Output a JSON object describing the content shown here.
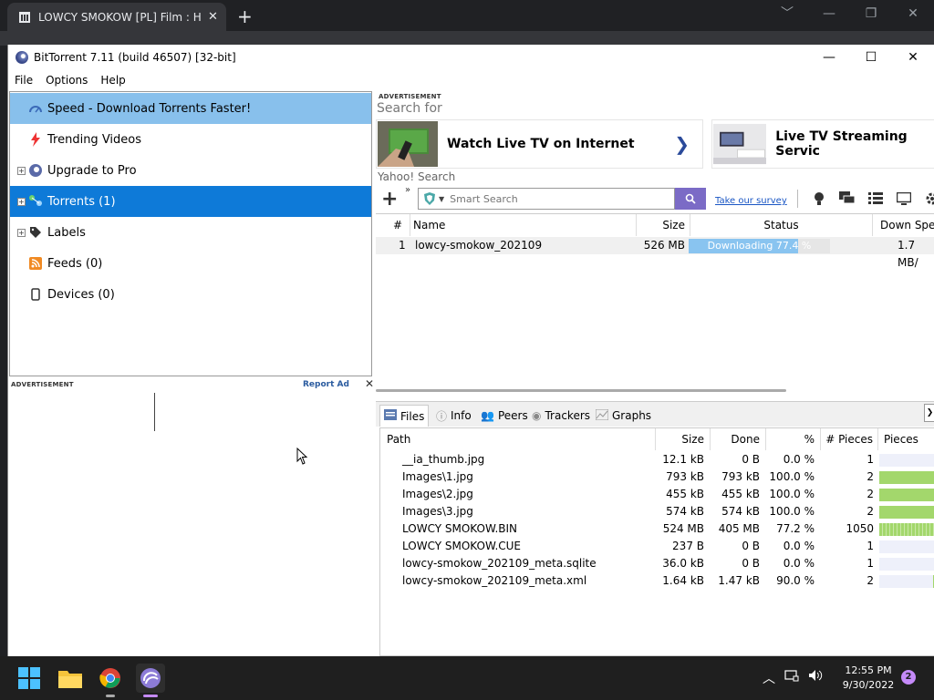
{
  "chrome": {
    "tab_title": "LOWCY SMOKOW [PL] Film : HAC",
    "tab_close": "✕",
    "new_tab": "+",
    "min": "﹀",
    "minimize": "—",
    "restore": "❐",
    "close": "✕"
  },
  "app": {
    "title": "BitTorrent 7.11  (build 46507) [32-bit]",
    "min": "—",
    "max": "☐",
    "close": "✕"
  },
  "menu": [
    "File",
    "Options",
    "Help"
  ],
  "sidebar": {
    "items": [
      {
        "label": "Speed - Download Torrents Faster!"
      },
      {
        "label": "Trending Videos"
      },
      {
        "label": "Upgrade to Pro"
      },
      {
        "label": "Torrents (1)"
      },
      {
        "label": "Labels"
      },
      {
        "label": "Feeds (0)"
      },
      {
        "label": "Devices (0)"
      }
    ],
    "expander": "+"
  },
  "side_ad": {
    "tag": "ADVERTISEMENT",
    "report": "Report Ad",
    "close": "✕"
  },
  "top_ad": {
    "tag": "ADVERTISEMENT",
    "search_for": "Search for",
    "banner1": "Watch Live TV on Internet",
    "banner1_chev": "❯",
    "banner2": "Live TV Streaming Servic",
    "yahoo": "Yahoo! Search"
  },
  "toolbar": {
    "add": "+",
    "more": "»",
    "search_placeholder": "Smart Search",
    "survey": "Take our survey"
  },
  "torrents": {
    "columns": [
      "#",
      "Name",
      "Size",
      "Status",
      "Down Speed"
    ],
    "rows": [
      {
        "num": "1",
        "name": "lowcy-smokow_202109",
        "size": "526 MB",
        "status": "Downloading 77.4 %",
        "progress": 0.774,
        "down": "1.7 MB/"
      }
    ]
  },
  "tabs": [
    "Files",
    "Info",
    "Peers",
    "Trackers",
    "Graphs"
  ],
  "tabs_collapse": "❯",
  "files": {
    "columns": [
      "Path",
      "Size",
      "Done",
      "%",
      "# Pieces",
      "Pieces"
    ],
    "rows": [
      {
        "path": "__ia_thumb.jpg",
        "size": "12.1 kB",
        "done": "0 B",
        "pct": "0.0 %",
        "pieces": "1",
        "fill": 0
      },
      {
        "path": "Images\\1.jpg",
        "size": "793 kB",
        "done": "793 kB",
        "pct": "100.0 %",
        "pieces": "2",
        "fill": 1
      },
      {
        "path": "Images\\2.jpg",
        "size": "455 kB",
        "done": "455 kB",
        "pct": "100.0 %",
        "pieces": "2",
        "fill": 1
      },
      {
        "path": "Images\\3.jpg",
        "size": "574 kB",
        "done": "574 kB",
        "pct": "100.0 %",
        "pieces": "2",
        "fill": 1
      },
      {
        "path": "LOWCY SMOKOW.BIN",
        "size": "524 MB",
        "done": "405 MB",
        "pct": "77.2 %",
        "pieces": "1050",
        "fill": 0.772
      },
      {
        "path": "LOWCY SMOKOW.CUE",
        "size": "237 B",
        "done": "0 B",
        "pct": "0.0 %",
        "pieces": "1",
        "fill": 0
      },
      {
        "path": "lowcy-smokow_202109_meta.sqlite",
        "size": "36.0 kB",
        "done": "0 B",
        "pct": "0.0 %",
        "pieces": "1",
        "fill": 0
      },
      {
        "path": "lowcy-smokow_202109_meta.xml",
        "size": "1.64 kB",
        "done": "1.47 kB",
        "pct": "90.0 %",
        "pieces": "2",
        "fill": 0.9
      }
    ]
  },
  "taskbar": {
    "tray_up": "︿",
    "time": "12:55 PM",
    "date": "9/30/2022",
    "notifications": "2"
  },
  "colors": {
    "selected_light": "#88c0ec",
    "selected_dark": "#0e7ad8",
    "progress": "#89c4f0",
    "pieces": "#a3d76c"
  }
}
